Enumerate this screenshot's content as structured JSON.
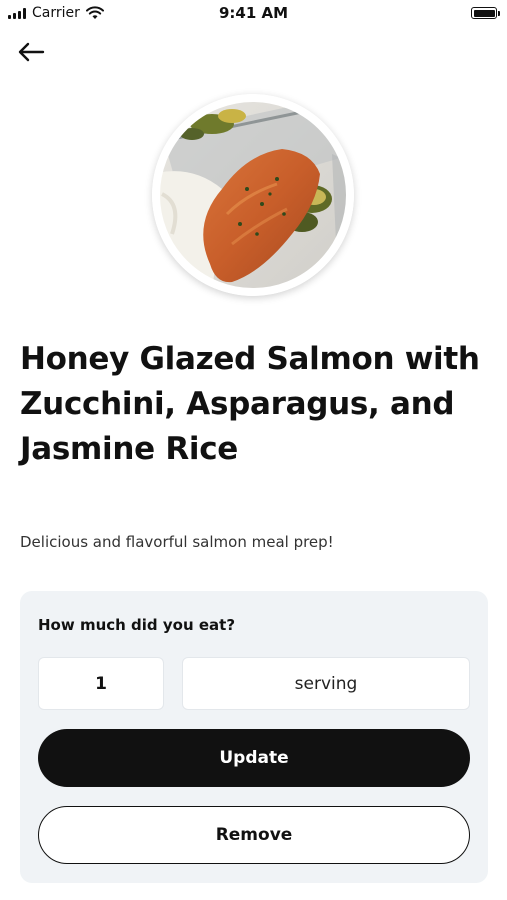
{
  "status_bar": {
    "carrier": "Carrier",
    "time": "9:41 AM",
    "signal_icon": "signal-bars-icon",
    "wifi_icon": "wifi-icon",
    "battery_icon": "battery-icon"
  },
  "navigation": {
    "back_icon": "arrow-left-icon"
  },
  "meal": {
    "photo_description_icon": "meal-photo",
    "title": "Honey Glazed Salmon with Zucchini, Asparagus, and Jasmine Rice",
    "description": "Delicious and flavorful salmon meal prep!"
  },
  "portion": {
    "question": "How much did you eat?",
    "quantity_value": "1",
    "unit_value": "serving",
    "update_label": "Update",
    "remove_label": "Remove"
  },
  "colors": {
    "background": "#ffffff",
    "card_background": "#f0f3f6",
    "primary_button": "#111111",
    "primary_button_text": "#ffffff",
    "text": "#111111"
  }
}
